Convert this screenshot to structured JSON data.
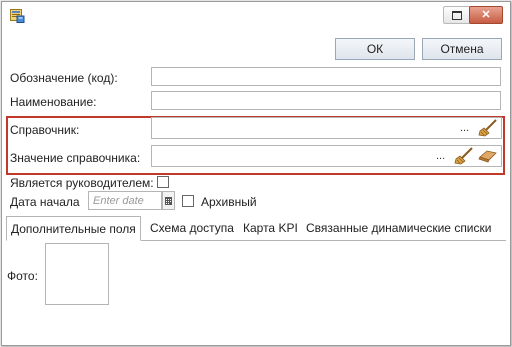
{
  "window": {
    "icon": "app-form-icon",
    "restore_icon": "restore-icon",
    "close_label": "✕"
  },
  "toolbar": {
    "ok_label": "ОК",
    "cancel_label": "Отмена"
  },
  "form": {
    "designation_label": "Обозначение (код):",
    "designation_value": "",
    "name_label": "Наименование:",
    "name_value": "",
    "reference_label": "Справочник:",
    "reference_value": "",
    "reference_ellipsis": "...",
    "reference_value_label": "Значение справочника:",
    "reference_value_value": "",
    "reference_value_ellipsis": "...",
    "is_manager_label": "Является руководителем:",
    "is_manager_checked": false,
    "start_date_label": "Дата начала",
    "start_date_placeholder": "Enter date",
    "archived_label": "Архивный",
    "archived_checked": false
  },
  "tabs": [
    {
      "label": "Дополнительные поля",
      "active": true
    },
    {
      "label": "Схема доступа",
      "active": false
    },
    {
      "label": "Карта KPI",
      "active": false
    },
    {
      "label": "Связанные динамические списки",
      "active": false
    }
  ],
  "tab_content": {
    "photo_label": "Фото:"
  },
  "colors": {
    "highlight_border": "#c0392b",
    "close_button": "#c75c44"
  }
}
